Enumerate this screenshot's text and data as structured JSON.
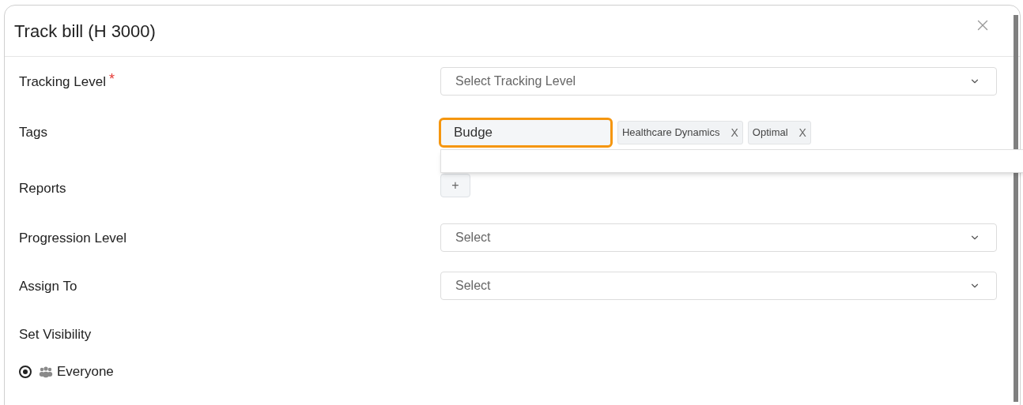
{
  "dialog": {
    "title": "Track bill (H 3000)",
    "required_marker": "*"
  },
  "fields": [
    {
      "kind": "select",
      "label": "Tracking Level",
      "required": true,
      "placeholder": "Select Tracking Level"
    },
    {
      "kind": "tags",
      "label": "Tags",
      "required": false,
      "value": "Budge",
      "focused": true,
      "suggestions_open": true,
      "tags": [
        {
          "label": "Healthcare Dynamics",
          "remove": "X"
        },
        {
          "label": "Optimal",
          "remove": "X"
        }
      ]
    },
    {
      "kind": "add",
      "label": "Reports",
      "required": false,
      "button": "+"
    },
    {
      "kind": "select",
      "label": "Progression Level",
      "required": false,
      "placeholder": "Select"
    },
    {
      "kind": "select",
      "label": "Assign To",
      "required": false,
      "placeholder": "Select"
    }
  ],
  "visibility": {
    "label": "Set Visibility",
    "options": [
      {
        "label": "Everyone",
        "selected": true
      }
    ]
  }
}
